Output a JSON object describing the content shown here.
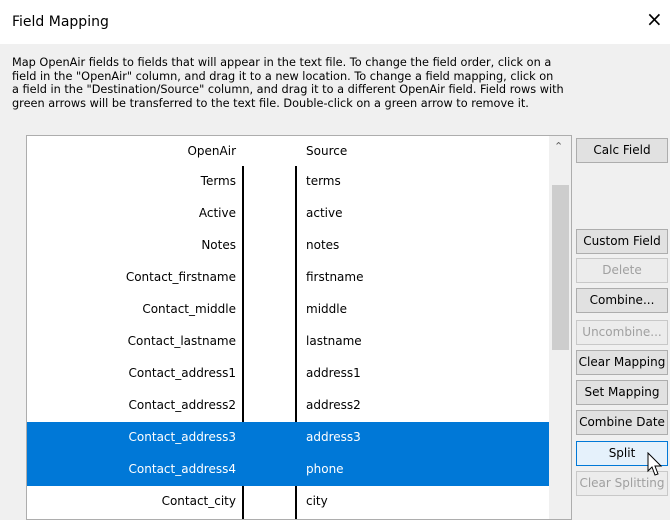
{
  "window": {
    "title": "Field Mapping",
    "close_glyph": "×"
  },
  "description": "Map OpenAir fields to fields that will appear in the text file. To change the field order, click on a\nfield in the \"OpenAir\" column, and drag it to a new location. To change a field mapping, click on\na field in the \"Destination/Source\" column, and drag it to a different OpenAir field. Field rows with\ngreen arrows will be transferred to the text file. Double-click on a green arrow to remove it.",
  "grid": {
    "header_left": "OpenAir",
    "header_right": "Source",
    "rows": [
      {
        "openair": "Terms",
        "source": "terms",
        "selected": false
      },
      {
        "openair": "Active",
        "source": "active",
        "selected": false
      },
      {
        "openair": "Notes",
        "source": "notes",
        "selected": false
      },
      {
        "openair": "Contact_firstname",
        "source": "firstname",
        "selected": false
      },
      {
        "openair": "Contact_middle",
        "source": "middle",
        "selected": false
      },
      {
        "openair": "Contact_lastname",
        "source": "lastname",
        "selected": false
      },
      {
        "openair": "Contact_address1",
        "source": "address1",
        "selected": false
      },
      {
        "openair": "Contact_address2",
        "source": "address2",
        "selected": false
      },
      {
        "openair": "Contact_address3",
        "source": "address3",
        "selected": true
      },
      {
        "openair": "Contact_address4",
        "source": "phone",
        "selected": true
      },
      {
        "openair": "Contact_city",
        "source": "city",
        "selected": false
      }
    ]
  },
  "buttons": {
    "calc_field": "Calc Field",
    "custom_field": "Custom Field",
    "delete": "Delete",
    "combine": "Combine...",
    "uncombine": "Uncombine...",
    "clear_mapping": "Clear Mapping",
    "set_mapping": "Set Mapping",
    "combine_date": "Combine Date",
    "split": "Split",
    "clear_splitting": "Clear Splitting"
  },
  "colors": {
    "selection": "#0078d7",
    "disabled_text": "#a0a0a0"
  }
}
